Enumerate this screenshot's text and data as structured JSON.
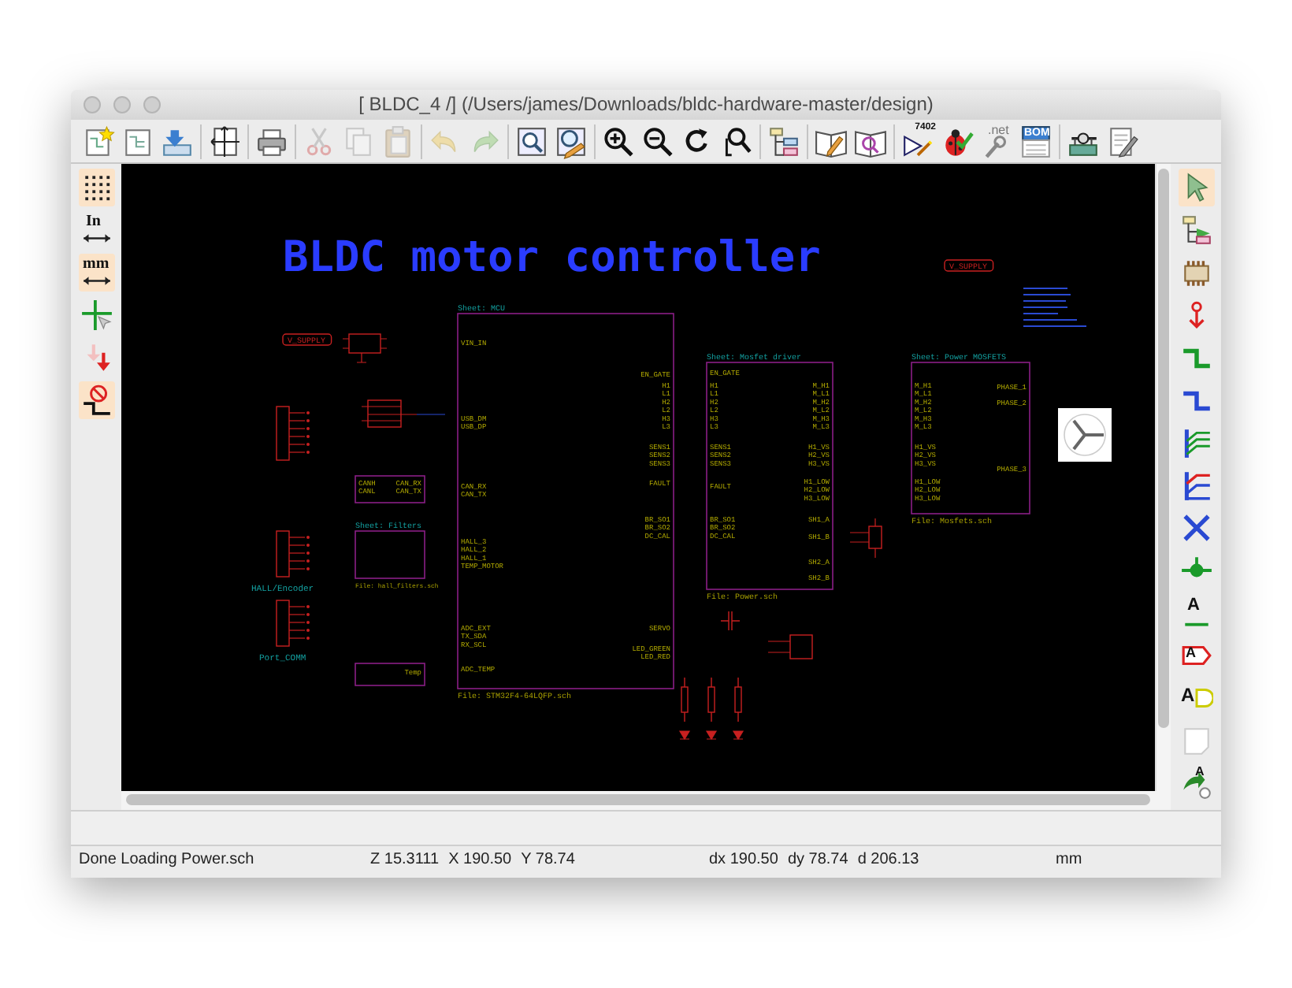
{
  "window": {
    "title": "[ BLDC_4 /] (/Users/james/Downloads/bldc-hardware-master/design)"
  },
  "main_toolbar": [
    {
      "kind": "new-sheet",
      "disabled": false
    },
    {
      "kind": "open-sheet",
      "disabled": false
    },
    {
      "kind": "save",
      "disabled": false
    },
    {
      "kind": "separator"
    },
    {
      "kind": "page-setup",
      "disabled": false
    },
    {
      "kind": "separator"
    },
    {
      "kind": "print",
      "disabled": false
    },
    {
      "kind": "separator"
    },
    {
      "kind": "cut",
      "disabled": true
    },
    {
      "kind": "copy",
      "disabled": true
    },
    {
      "kind": "paste",
      "disabled": true
    },
    {
      "kind": "separator"
    },
    {
      "kind": "undo",
      "disabled": true
    },
    {
      "kind": "redo",
      "disabled": true
    },
    {
      "kind": "separator"
    },
    {
      "kind": "find",
      "disabled": false
    },
    {
      "kind": "find-replace",
      "disabled": false
    },
    {
      "kind": "separator"
    },
    {
      "kind": "zoom-in",
      "disabled": false
    },
    {
      "kind": "zoom-out",
      "disabled": false
    },
    {
      "kind": "redraw",
      "disabled": false
    },
    {
      "kind": "zoom-fit",
      "disabled": false
    },
    {
      "kind": "separator"
    },
    {
      "kind": "hierarchy",
      "disabled": false
    },
    {
      "kind": "separator"
    },
    {
      "kind": "library-edit",
      "disabled": false
    },
    {
      "kind": "library-browse",
      "disabled": false
    },
    {
      "kind": "separator"
    },
    {
      "kind": "annotate",
      "disabled": false,
      "text": "7402"
    },
    {
      "kind": "erc",
      "disabled": false
    },
    {
      "kind": "netlist",
      "disabled": false,
      "text": ".net"
    },
    {
      "kind": "bom",
      "disabled": false,
      "text": "BOM"
    },
    {
      "kind": "separator"
    },
    {
      "kind": "footprint-assign",
      "disabled": false
    },
    {
      "kind": "back-annotate",
      "disabled": false
    }
  ],
  "left_toolbar": [
    {
      "kind": "grid",
      "selected": true
    },
    {
      "kind": "inches",
      "selected": false,
      "text": "In"
    },
    {
      "kind": "millimeters",
      "selected": true,
      "text": "mm"
    },
    {
      "kind": "cursor",
      "selected": false
    },
    {
      "kind": "hidden-pins",
      "selected": false
    },
    {
      "kind": "wire-angle",
      "selected": true
    }
  ],
  "right_toolbar": [
    {
      "kind": "pointer",
      "selected": true
    },
    {
      "kind": "hierarchy-nav",
      "selected": false
    },
    {
      "kind": "component",
      "selected": false
    },
    {
      "kind": "power-port",
      "selected": false
    },
    {
      "kind": "wire",
      "selected": false
    },
    {
      "kind": "bus",
      "selected": false
    },
    {
      "kind": "wire-entry",
      "selected": false
    },
    {
      "kind": "bus-entry",
      "selected": false
    },
    {
      "kind": "no-connect",
      "selected": false
    },
    {
      "kind": "junction",
      "selected": false
    },
    {
      "kind": "net-label",
      "selected": false,
      "text": "A"
    },
    {
      "kind": "global-label",
      "selected": false,
      "text": "A"
    },
    {
      "kind": "hier-label",
      "selected": false,
      "text": "A"
    },
    {
      "kind": "sheet",
      "selected": false
    },
    {
      "kind": "import-pins",
      "selected": false,
      "text": "A"
    }
  ],
  "schematic": {
    "title": "BLDC motor controller",
    "sheets": [
      {
        "name": "Sheet: MCU",
        "file": "File: STM32F4-64LQFP.sch",
        "left_pins": [
          [
            "VIN_IN"
          ],
          [
            "USB_DM",
            "USB_DP"
          ],
          [
            "CAN_RX",
            "CAN_TX"
          ],
          [
            "HALL_3",
            "HALL_2",
            "HALL_1",
            "TEMP_MOTOR"
          ],
          [
            "ADC_EXT",
            "TX_SDA",
            "RX_SCL"
          ],
          [
            "ADC_TEMP"
          ]
        ],
        "right_pins": [
          [
            "EN_GATE"
          ],
          [
            "H1",
            "L1",
            "H2",
            "L2",
            "H3",
            "L3"
          ],
          [
            "SENS1",
            "SENS2",
            "SENS3"
          ],
          [
            "FAULT"
          ],
          [
            "BR_SO1",
            "BR_SO2",
            "DC_CAL"
          ],
          [
            "SERVO"
          ],
          [
            "LED_GREEN",
            "LED_RED"
          ]
        ]
      },
      {
        "name": "Sheet: Mosfet driver",
        "file": "File: Power.sch",
        "left_pins": [
          [
            "EN_GATE"
          ],
          [
            "H1",
            "L1",
            "H2",
            "L2",
            "H3",
            "L3"
          ],
          [
            "SENS1",
            "SENS2",
            "SENS3"
          ],
          [
            "FAULT"
          ],
          [
            "BR_SO1",
            "BR_SO2",
            "DC_CAL"
          ]
        ],
        "right_pins": [
          [
            "M_H1",
            "M_L1",
            "M_H2",
            "M_L2",
            "M_H3",
            "M_L3"
          ],
          [
            "H1_VS",
            "H2_VS",
            "H3_VS"
          ],
          [
            "H1_LOW",
            "H2_LOW",
            "H3_LOW"
          ],
          [
            "SH1_A"
          ],
          [
            "SH1_B"
          ],
          [
            "SH2_A"
          ],
          [
            "SH2_B"
          ]
        ]
      },
      {
        "name": "Sheet: Power MOSFETS",
        "file": "File: Mosfets.sch",
        "left_pins": [
          [
            "M_H1",
            "M_L1",
            "M_H2",
            "M_L2",
            "M_H3",
            "M_L3"
          ],
          [
            "H1_VS",
            "H2_VS",
            "H3_VS"
          ],
          [
            "H1_LOW",
            "H2_LOW",
            "H3_LOW"
          ]
        ],
        "right_pins": [
          [
            "PHASE_1"
          ],
          [
            "PHASE_2"
          ],
          [
            "PHASE_3"
          ]
        ]
      },
      {
        "left_pins": [
          [
            "CANH",
            "CANL"
          ]
        ],
        "right_pins": [
          [
            "CAN_RX",
            "CAN_TX"
          ]
        ]
      },
      {
        "name": "Sheet: Filters",
        "file": "File: hall_filters.sch"
      },
      {
        "right_pins": [
          [
            "Temp"
          ]
        ]
      }
    ],
    "labels": [
      {
        "kind": "global",
        "text": "V_SUPPLY"
      },
      {
        "kind": "global",
        "text": "V_SUPPLY"
      },
      {
        "kind": "reference",
        "text": "HALL/Encoder"
      },
      {
        "kind": "reference",
        "text": "Port_COMM"
      }
    ]
  },
  "status_bar": [
    [
      "Done Loading Power.sch"
    ],
    [
      "Z 15.3111",
      "X 190.50",
      "Y 78.74"
    ],
    [
      "dx 190.50",
      "dy 78.74",
      "d 206.13"
    ],
    [
      "mm"
    ]
  ]
}
